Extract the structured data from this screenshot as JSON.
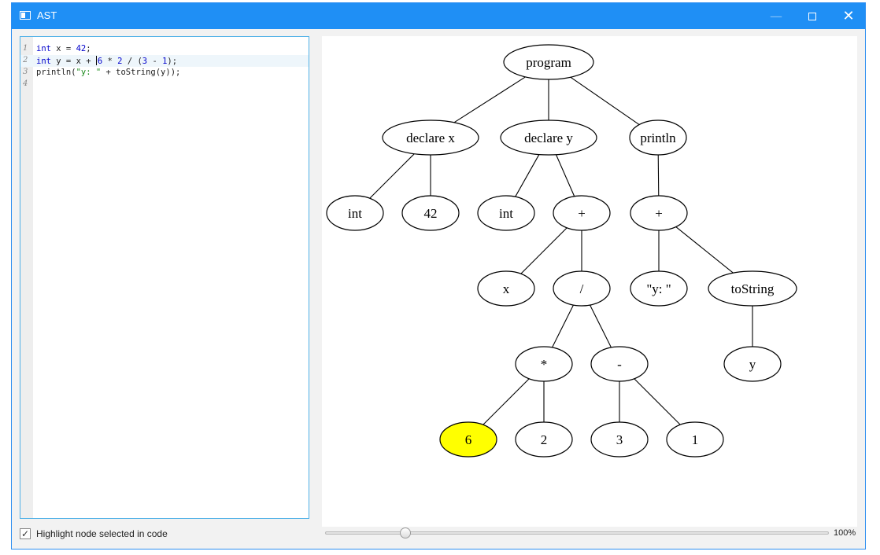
{
  "window": {
    "title": "AST",
    "minimize_glyph": "—",
    "close_glyph": "✕"
  },
  "editor": {
    "lines": [
      {
        "n": "1",
        "tokens": [
          {
            "t": "int",
            "c": "kw"
          },
          {
            "t": " x = "
          },
          {
            "t": "42",
            "c": "num"
          },
          {
            "t": ";"
          }
        ]
      },
      {
        "n": "2",
        "active": true,
        "tokens": [
          {
            "t": "int",
            "c": "kw"
          },
          {
            "t": " y = x + "
          },
          {
            "caret": true
          },
          {
            "t": "6",
            "c": "num"
          },
          {
            "t": " * "
          },
          {
            "t": "2",
            "c": "num"
          },
          {
            "t": " / ("
          },
          {
            "t": "3",
            "c": "num"
          },
          {
            "t": " - "
          },
          {
            "t": "1",
            "c": "num"
          },
          {
            "t": ");"
          }
        ]
      },
      {
        "n": "3",
        "tokens": [
          {
            "t": "println("
          },
          {
            "t": "\"y: \"",
            "c": "str"
          },
          {
            "t": " + toString(y));"
          }
        ]
      },
      {
        "n": "4",
        "tokens": []
      }
    ]
  },
  "ast": {
    "highlight_color": "#ffff00",
    "nodes": [
      {
        "id": "program",
        "label": "program"
      },
      {
        "id": "declare_x",
        "label": "declare x"
      },
      {
        "id": "declare_y",
        "label": "declare y"
      },
      {
        "id": "println",
        "label": "println"
      },
      {
        "id": "int_x",
        "label": "int"
      },
      {
        "id": "n42",
        "label": "42"
      },
      {
        "id": "int_y",
        "label": "int"
      },
      {
        "id": "plus_y",
        "label": "+"
      },
      {
        "id": "plus_p",
        "label": "+"
      },
      {
        "id": "x",
        "label": "x"
      },
      {
        "id": "div",
        "label": "/"
      },
      {
        "id": "str_y",
        "label": "\"y: \""
      },
      {
        "id": "tostring",
        "label": "toString"
      },
      {
        "id": "mul",
        "label": "*"
      },
      {
        "id": "minus",
        "label": "-"
      },
      {
        "id": "y",
        "label": "y"
      },
      {
        "id": "n6",
        "label": "6",
        "highlighted": true
      },
      {
        "id": "n2",
        "label": "2"
      },
      {
        "id": "n3",
        "label": "3"
      },
      {
        "id": "n1",
        "label": "1"
      }
    ],
    "edges": [
      [
        "program",
        "declare_x"
      ],
      [
        "program",
        "declare_y"
      ],
      [
        "program",
        "println"
      ],
      [
        "declare_x",
        "int_x"
      ],
      [
        "declare_x",
        "n42"
      ],
      [
        "declare_y",
        "int_y"
      ],
      [
        "declare_y",
        "plus_y"
      ],
      [
        "println",
        "plus_p"
      ],
      [
        "plus_y",
        "x"
      ],
      [
        "plus_y",
        "div"
      ],
      [
        "plus_p",
        "str_y"
      ],
      [
        "plus_p",
        "tostring"
      ],
      [
        "div",
        "mul"
      ],
      [
        "div",
        "minus"
      ],
      [
        "tostring",
        "y"
      ],
      [
        "mul",
        "n6"
      ],
      [
        "mul",
        "n2"
      ],
      [
        "minus",
        "n3"
      ],
      [
        "minus",
        "n1"
      ]
    ]
  },
  "controls": {
    "highlight_checkbox_label": "Highlight node selected in code",
    "highlight_checked": true,
    "checkmark_glyph": "✓",
    "zoom_fraction": 0.16,
    "zoom_label": "100%"
  }
}
